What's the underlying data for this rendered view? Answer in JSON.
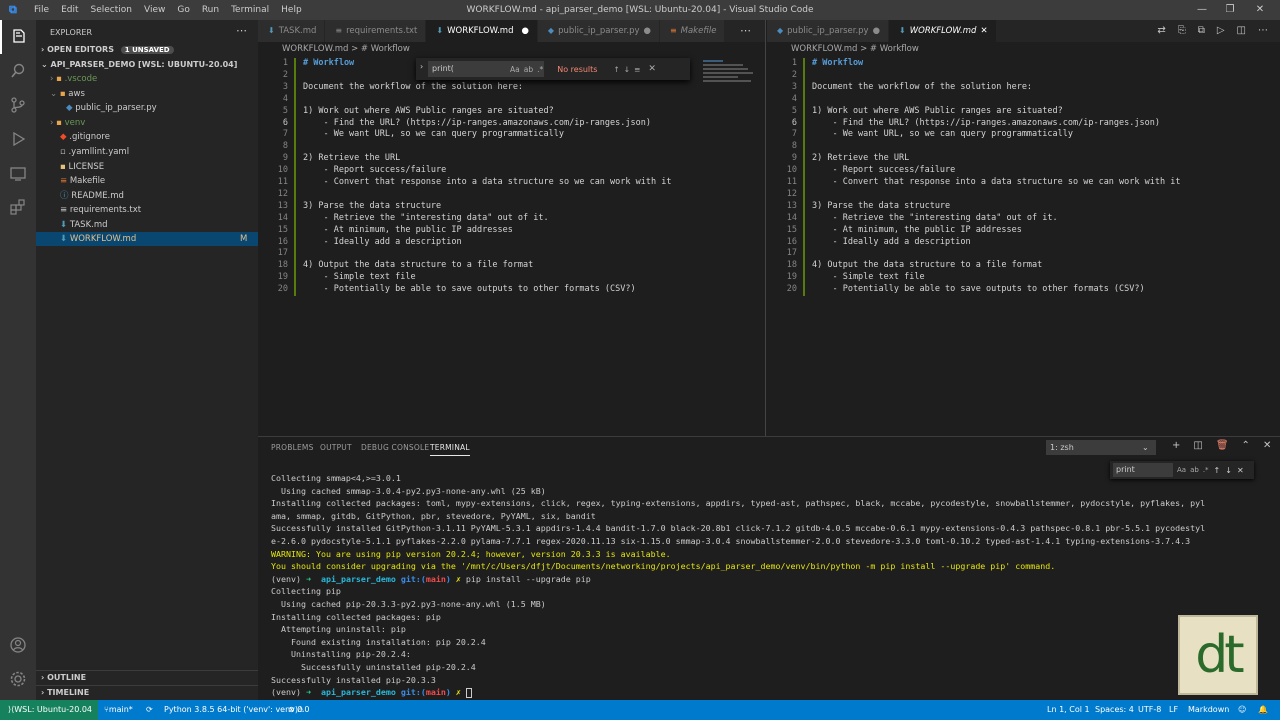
{
  "titlebar": {
    "menu": [
      "File",
      "Edit",
      "Selection",
      "View",
      "Go",
      "Run",
      "Terminal",
      "Help"
    ],
    "title": "WORKFLOW.md - api_parser_demo [WSL: Ubuntu-20.04] - Visual Studio Code"
  },
  "sidebar": {
    "header": "EXPLORER",
    "open_editors": "OPEN EDITORS",
    "unsaved_badge": "1 UNSAVED",
    "root": "API_PARSER_DEMO [WSL: UBUNTU-20.04]",
    "items": [
      {
        "label": ".vscode",
        "kind": "folder",
        "color": "#6a9955"
      },
      {
        "label": "aws",
        "kind": "folder-open",
        "color": "#cccccc"
      },
      {
        "label": "public_ip_parser.py",
        "kind": "python",
        "color": "#cccccc"
      },
      {
        "label": "venv",
        "kind": "folder",
        "color": "#6a9955"
      },
      {
        "label": ".gitignore",
        "kind": "git",
        "color": "#cccccc"
      },
      {
        "label": ".yamllint.yaml",
        "kind": "file",
        "color": "#cccccc"
      },
      {
        "label": "LICENSE",
        "kind": "license",
        "color": "#cccccc"
      },
      {
        "label": "Makefile",
        "kind": "make",
        "color": "#cccccc"
      },
      {
        "label": "README.md",
        "kind": "md",
        "color": "#cccccc"
      },
      {
        "label": "requirements.txt",
        "kind": "txt",
        "color": "#cccccc"
      },
      {
        "label": "TASK.md",
        "kind": "md",
        "color": "#cccccc"
      },
      {
        "label": "WORKFLOW.md",
        "kind": "md",
        "color": "#ffffff",
        "badge": "M"
      }
    ],
    "outline": "OUTLINE",
    "timeline": "TIMELINE"
  },
  "left_editor": {
    "tabs": [
      {
        "label": "TASK.md",
        "active": false
      },
      {
        "label": "requirements.txt",
        "active": false
      },
      {
        "label": "WORKFLOW.md",
        "active": true
      },
      {
        "label": "public_ip_parser.py",
        "active": false
      },
      {
        "label": "Makefile",
        "active": false
      }
    ],
    "breadcrumb": "WORKFLOW.md > # Workflow"
  },
  "right_editor": {
    "tabs": [
      {
        "label": "public_ip_parser.py",
        "active": false
      },
      {
        "label": "WORKFLOW.md",
        "active": true
      }
    ],
    "breadcrumb": "WORKFLOW.md > # Workflow"
  },
  "find_widget": {
    "query": "print(",
    "case": "Aa",
    "word": "ab",
    "regex": ".*",
    "result": "No results"
  },
  "document_lines": [
    "# Workflow",
    "",
    "Document the workflow of the solution here:",
    "",
    "1) Work out where AWS Public ranges are situated?",
    "    - Find the URL? (https://ip-ranges.amazonaws.com/ip-ranges.json)",
    "    - We want URL, so we can query programmatically",
    "",
    "2) Retrieve the URL",
    "    - Report success/failure",
    "    - Convert that response into a data structure so we can work with it",
    "",
    "3) Parse the data structure",
    "    - Retrieve the \"interesting data\" out of it.",
    "    - At minimum, the public IP addresses",
    "    - Ideally add a description",
    "",
    "4) Output the data structure to a file format",
    "    - Simple text file",
    "    - Potentially be able to save outputs to other formats (CSV?)"
  ],
  "line_numbers": [
    "1",
    "2",
    "3",
    "4",
    "5",
    "6",
    "7",
    "8",
    "9",
    "10",
    "11",
    "12",
    "13",
    "14",
    "15",
    "16",
    "17",
    "18",
    "19",
    "20"
  ],
  "panel": {
    "tabs": [
      "PROBLEMS",
      "OUTPUT",
      "DEBUG CONSOLE",
      "TERMINAL"
    ],
    "active_tab": "TERMINAL",
    "terminal_select": "1: zsh",
    "terminal_find": "print",
    "lines": [
      "Collecting smmap<4,>=3.0.1",
      "  Using cached smmap-3.0.4-py2.py3-none-any.whl (25 kB)",
      "Installing collected packages: toml, mypy-extensions, click, regex, typing-extensions, appdirs, typed-ast, pathspec, black, mccabe, pycodestyle, snowballstemmer, pydocstyle, pyflakes, pyl",
      "ama, smmap, gitdb, GitPython, pbr, stevedore, PyYAML, six, bandit",
      "Successfully installed GitPython-3.1.11 PyYAML-5.3.1 appdirs-1.4.4 bandit-1.7.0 black-20.8b1 click-7.1.2 gitdb-4.0.5 mccabe-0.6.1 mypy-extensions-0.4.3 pathspec-0.8.1 pbr-5.5.1 pycodestyl",
      "e-2.6.0 pydocstyle-5.1.1 pyflakes-2.2.0 pylama-7.7.1 regex-2020.11.13 six-1.15.0 smmap-3.0.4 snowballstemmer-2.0.0 stevedore-3.3.0 toml-0.10.2 typed-ast-1.4.1 typing-extensions-3.7.4.3",
      "WARNING: You are using pip version 20.2.4; however, version 20.3.3 is available.",
      "You should consider upgrading via the '/mnt/c/Users/dfjt/Documents/networking/projects/api_parser_demo/venv/bin/python -m pip install --upgrade pip' command.",
      "PROMPT1",
      "Collecting pip",
      "  Using cached pip-20.3.3-py2.py3-none-any.whl (1.5 MB)",
      "Installing collected packages: pip",
      "  Attempting uninstall: pip",
      "    Found existing installation: pip 20.2.4",
      "    Uninstalling pip-20.2.4:",
      "      Successfully uninstalled pip-20.2.4",
      "Successfully installed pip-20.3.3",
      "PROMPT2"
    ],
    "prompt": {
      "venv": "(venv)",
      "arrow": "➜",
      "dir": "api_parser_demo",
      "git": "git:(",
      "branch": "main",
      "git_close": ")",
      "x": "✗",
      "cmd1": "pip install --upgrade pip"
    }
  },
  "statusbar": {
    "remote": "WSL: Ubuntu-20.04",
    "branch": "main*",
    "python": "Python 3.8.5 64-bit ('venv': venv)",
    "problems": "0",
    "warnings": "0",
    "position": "Ln 1, Col 1",
    "spaces": "Spaces: 4",
    "encoding": "UTF-8",
    "eol": "LF",
    "language": "Markdown"
  },
  "logo_text": "dt",
  "colors": {
    "accent": "#007acc",
    "remote": "#16825d",
    "selection": "#094771"
  }
}
